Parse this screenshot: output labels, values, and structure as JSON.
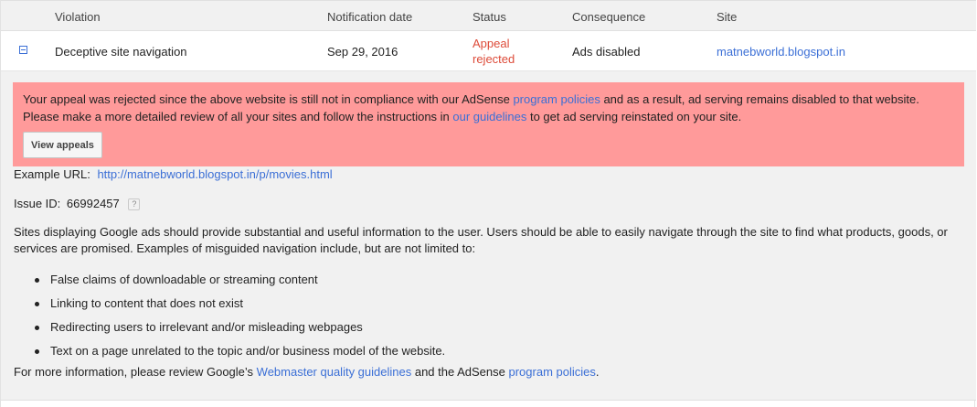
{
  "table": {
    "headers": {
      "violation": "Violation",
      "notification_date": "Notification date",
      "status": "Status",
      "consequence": "Consequence",
      "site": "Site"
    },
    "row": {
      "violation": "Deceptive site navigation",
      "notification_date": "Sep 29, 2016",
      "status_line1": "Appeal",
      "status_line2": "rejected",
      "consequence": "Ads disabled",
      "site": "matnebworld.blogspot.in"
    }
  },
  "alert": {
    "text1": "Your appeal was rejected since the above website is still not in compliance with our AdSense ",
    "link1": "program policies",
    "text2": " and as a result, ad serving remains disabled to that website.",
    "text3": "Please make a more detailed review of all your sites and follow the instructions in ",
    "link2": "our guidelines",
    "text4": " to get ad serving reinstated on your site.",
    "button_label": "View appeals"
  },
  "details": {
    "example_url_label": "Example URL:",
    "example_url": "http://matnebworld.blogspot.in/p/movies.html",
    "issue_id_label": "Issue ID:",
    "issue_id": "66992457",
    "help_glyph": "?",
    "description": "Sites displaying Google ads should provide substantial and useful information to the user. Users should be able to easily navigate through the site to find what products, goods, or services are promised. Examples of misguided navigation include, but are not limited to:",
    "bullets": [
      "False claims of downloadable or streaming content",
      "Linking to content that does not exist",
      "Redirecting users to irrelevant and/or misleading webpages",
      "Text on a page unrelated to the topic and/or business model of the website."
    ],
    "footer_text1": "For more information, please review Google’s ",
    "footer_link1": "Webmaster quality guidelines",
    "footer_text2": " and the AdSense ",
    "footer_link2": "program policies",
    "footer_text3": "."
  },
  "colors": {
    "alert_bg": "#ff9a9a",
    "link": "#3b6fd6",
    "status_rejected": "#dd4b39",
    "panel_bg": "#f1f1f1"
  },
  "icons": {
    "collapse": "collapse-minus-icon",
    "help": "help-question-icon",
    "bullet": "bullet-dot-icon"
  }
}
